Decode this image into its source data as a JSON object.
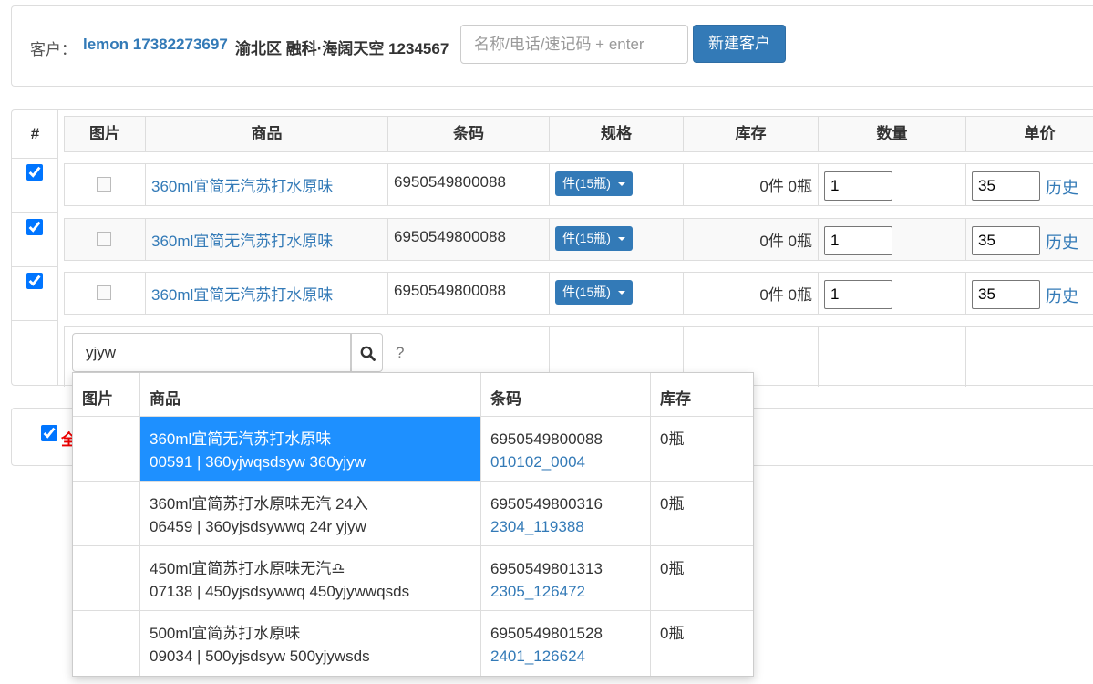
{
  "customer": {
    "label": "客户：",
    "name_phone": "lemon 17382273697",
    "address": "渝北区 融科·海阔天空 1234567",
    "search_placeholder": "名称/电话/速记码 + enter",
    "new_button": "新建客户"
  },
  "table": {
    "hash_header": "#",
    "headers": [
      "图片",
      "商品",
      "条码",
      "规格",
      "库存",
      "数量",
      "单价"
    ],
    "rows": [
      {
        "checked": true,
        "name": "360ml宜简无汽苏打水原味",
        "barcode": "6950549800088",
        "spec": "件(15瓶)",
        "stock": "0件 0瓶",
        "qty": "1",
        "price": "35",
        "history": "历史"
      },
      {
        "checked": true,
        "name": "360ml宜简无汽苏打水原味",
        "barcode": "6950549800088",
        "spec": "件(15瓶)",
        "stock": "0件 0瓶",
        "qty": "1",
        "price": "35",
        "history": "历史"
      },
      {
        "checked": true,
        "name": "360ml宜简无汽苏打水原味",
        "barcode": "6950549800088",
        "spec": "件(15瓶)",
        "stock": "0件 0瓶",
        "qty": "1",
        "price": "35",
        "history": "历史"
      }
    ],
    "search_value": "yjyw",
    "search_hint": "?"
  },
  "bottom": {
    "select_all_checked": true,
    "select_all_label": "全"
  },
  "dropdown": {
    "headers": [
      "图片",
      "商品",
      "条码",
      "库存"
    ],
    "items": [
      {
        "name": "360ml宜简无汽苏打水原味",
        "codes": "00591 | 360yjwqsdsyw 360yjyw",
        "barcode": "6950549800088",
        "sku": "010102_0004",
        "stock": "0瓶",
        "active": true
      },
      {
        "name": "360ml宜简苏打水原味无汽 24入",
        "codes": "06459 | 360yjsdsywwq 24r yjyw",
        "barcode": "6950549800316",
        "sku": "2304_119388",
        "stock": "0瓶",
        "active": false
      },
      {
        "name": "450ml宜简苏打水原味无汽♎",
        "codes": "07138 | 450yjsdsywwq 450yjywwqsds",
        "barcode": "6950549801313",
        "sku": "2305_126472",
        "stock": "0瓶",
        "active": false
      },
      {
        "name": "500ml宜简苏打水原味",
        "codes": "09034 | 500yjsdsyw 500yjywsds",
        "barcode": "6950549801528",
        "sku": "2401_126624",
        "stock": "0瓶",
        "active": false
      }
    ]
  },
  "colors": {
    "primary": "#337ab7",
    "highlight": "#1e90ff",
    "select_all_red": "#ee0000"
  }
}
